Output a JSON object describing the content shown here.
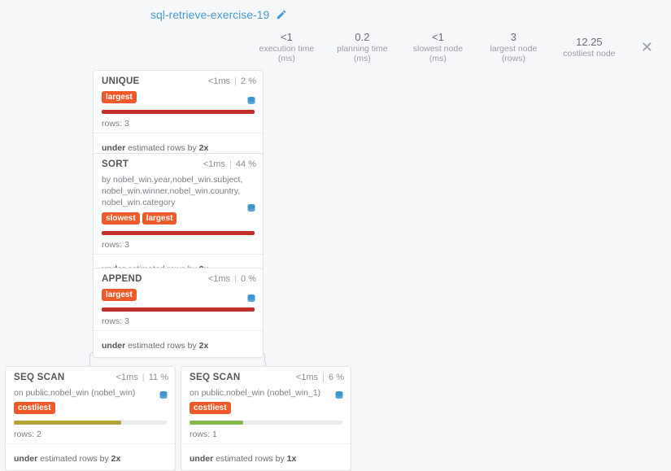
{
  "title": "sql-retrieve-exercise-19",
  "stats": {
    "exec": {
      "val": "<1",
      "lbl": "execution time (ms)"
    },
    "plan": {
      "val": "0.2",
      "lbl": "planning time (ms)"
    },
    "slow": {
      "val": "<1",
      "lbl": "slowest node (ms)"
    },
    "large": {
      "val": "3",
      "lbl": "largest node (rows)"
    },
    "cost": {
      "val": "12.25",
      "lbl": "costliest node"
    }
  },
  "nodes": {
    "unique": {
      "name": "UNIQUE",
      "ms": "<1ms",
      "pct": "2 %",
      "badges": [
        "largest"
      ],
      "rows": "rows: 3",
      "est_bold1": "under",
      "est_mid": " estimated rows by ",
      "est_bold2": "2x",
      "bar_w": "100%",
      "bar_class": "bar-red"
    },
    "sort": {
      "name": "SORT",
      "ms": "<1ms",
      "pct": "44 %",
      "desc": "by nobel_win.year,nobel_win.subject, nobel_win.winner,nobel_win.country, nobel_win.category",
      "badges": [
        "slowest",
        "largest"
      ],
      "rows": "rows: 3",
      "est_bold1": "under",
      "est_mid": " estimated rows by ",
      "est_bold2": "2x",
      "bar_w": "100%",
      "bar_class": "bar-red"
    },
    "append": {
      "name": "APPEND",
      "ms": "<1ms",
      "pct": "0 %",
      "badges": [
        "largest"
      ],
      "rows": "rows: 3",
      "est_bold1": "under",
      "est_mid": " estimated rows by ",
      "est_bold2": "2x",
      "bar_w": "100%",
      "bar_class": "bar-red"
    },
    "seq1": {
      "name": "SEQ SCAN",
      "ms": "<1ms",
      "pct": "11 %",
      "desc": "on public.nobel_win (nobel_win)",
      "badges": [
        "costliest"
      ],
      "rows": "rows: 2",
      "est_bold1": "under",
      "est_mid": " estimated rows by ",
      "est_bold2": "2x",
      "bar_w": "70%",
      "bar_class": "bar-olive"
    },
    "seq2": {
      "name": "SEQ SCAN",
      "ms": "<1ms",
      "pct": "6 %",
      "desc": "on public.nobel_win (nobel_win_1)",
      "badges": [
        "costliest"
      ],
      "rows": "rows: 1",
      "est_bold1": "under",
      "est_mid": " estimated rows by ",
      "est_bold2": "1x",
      "bar_w": "35%",
      "bar_class": "bar-green"
    }
  }
}
